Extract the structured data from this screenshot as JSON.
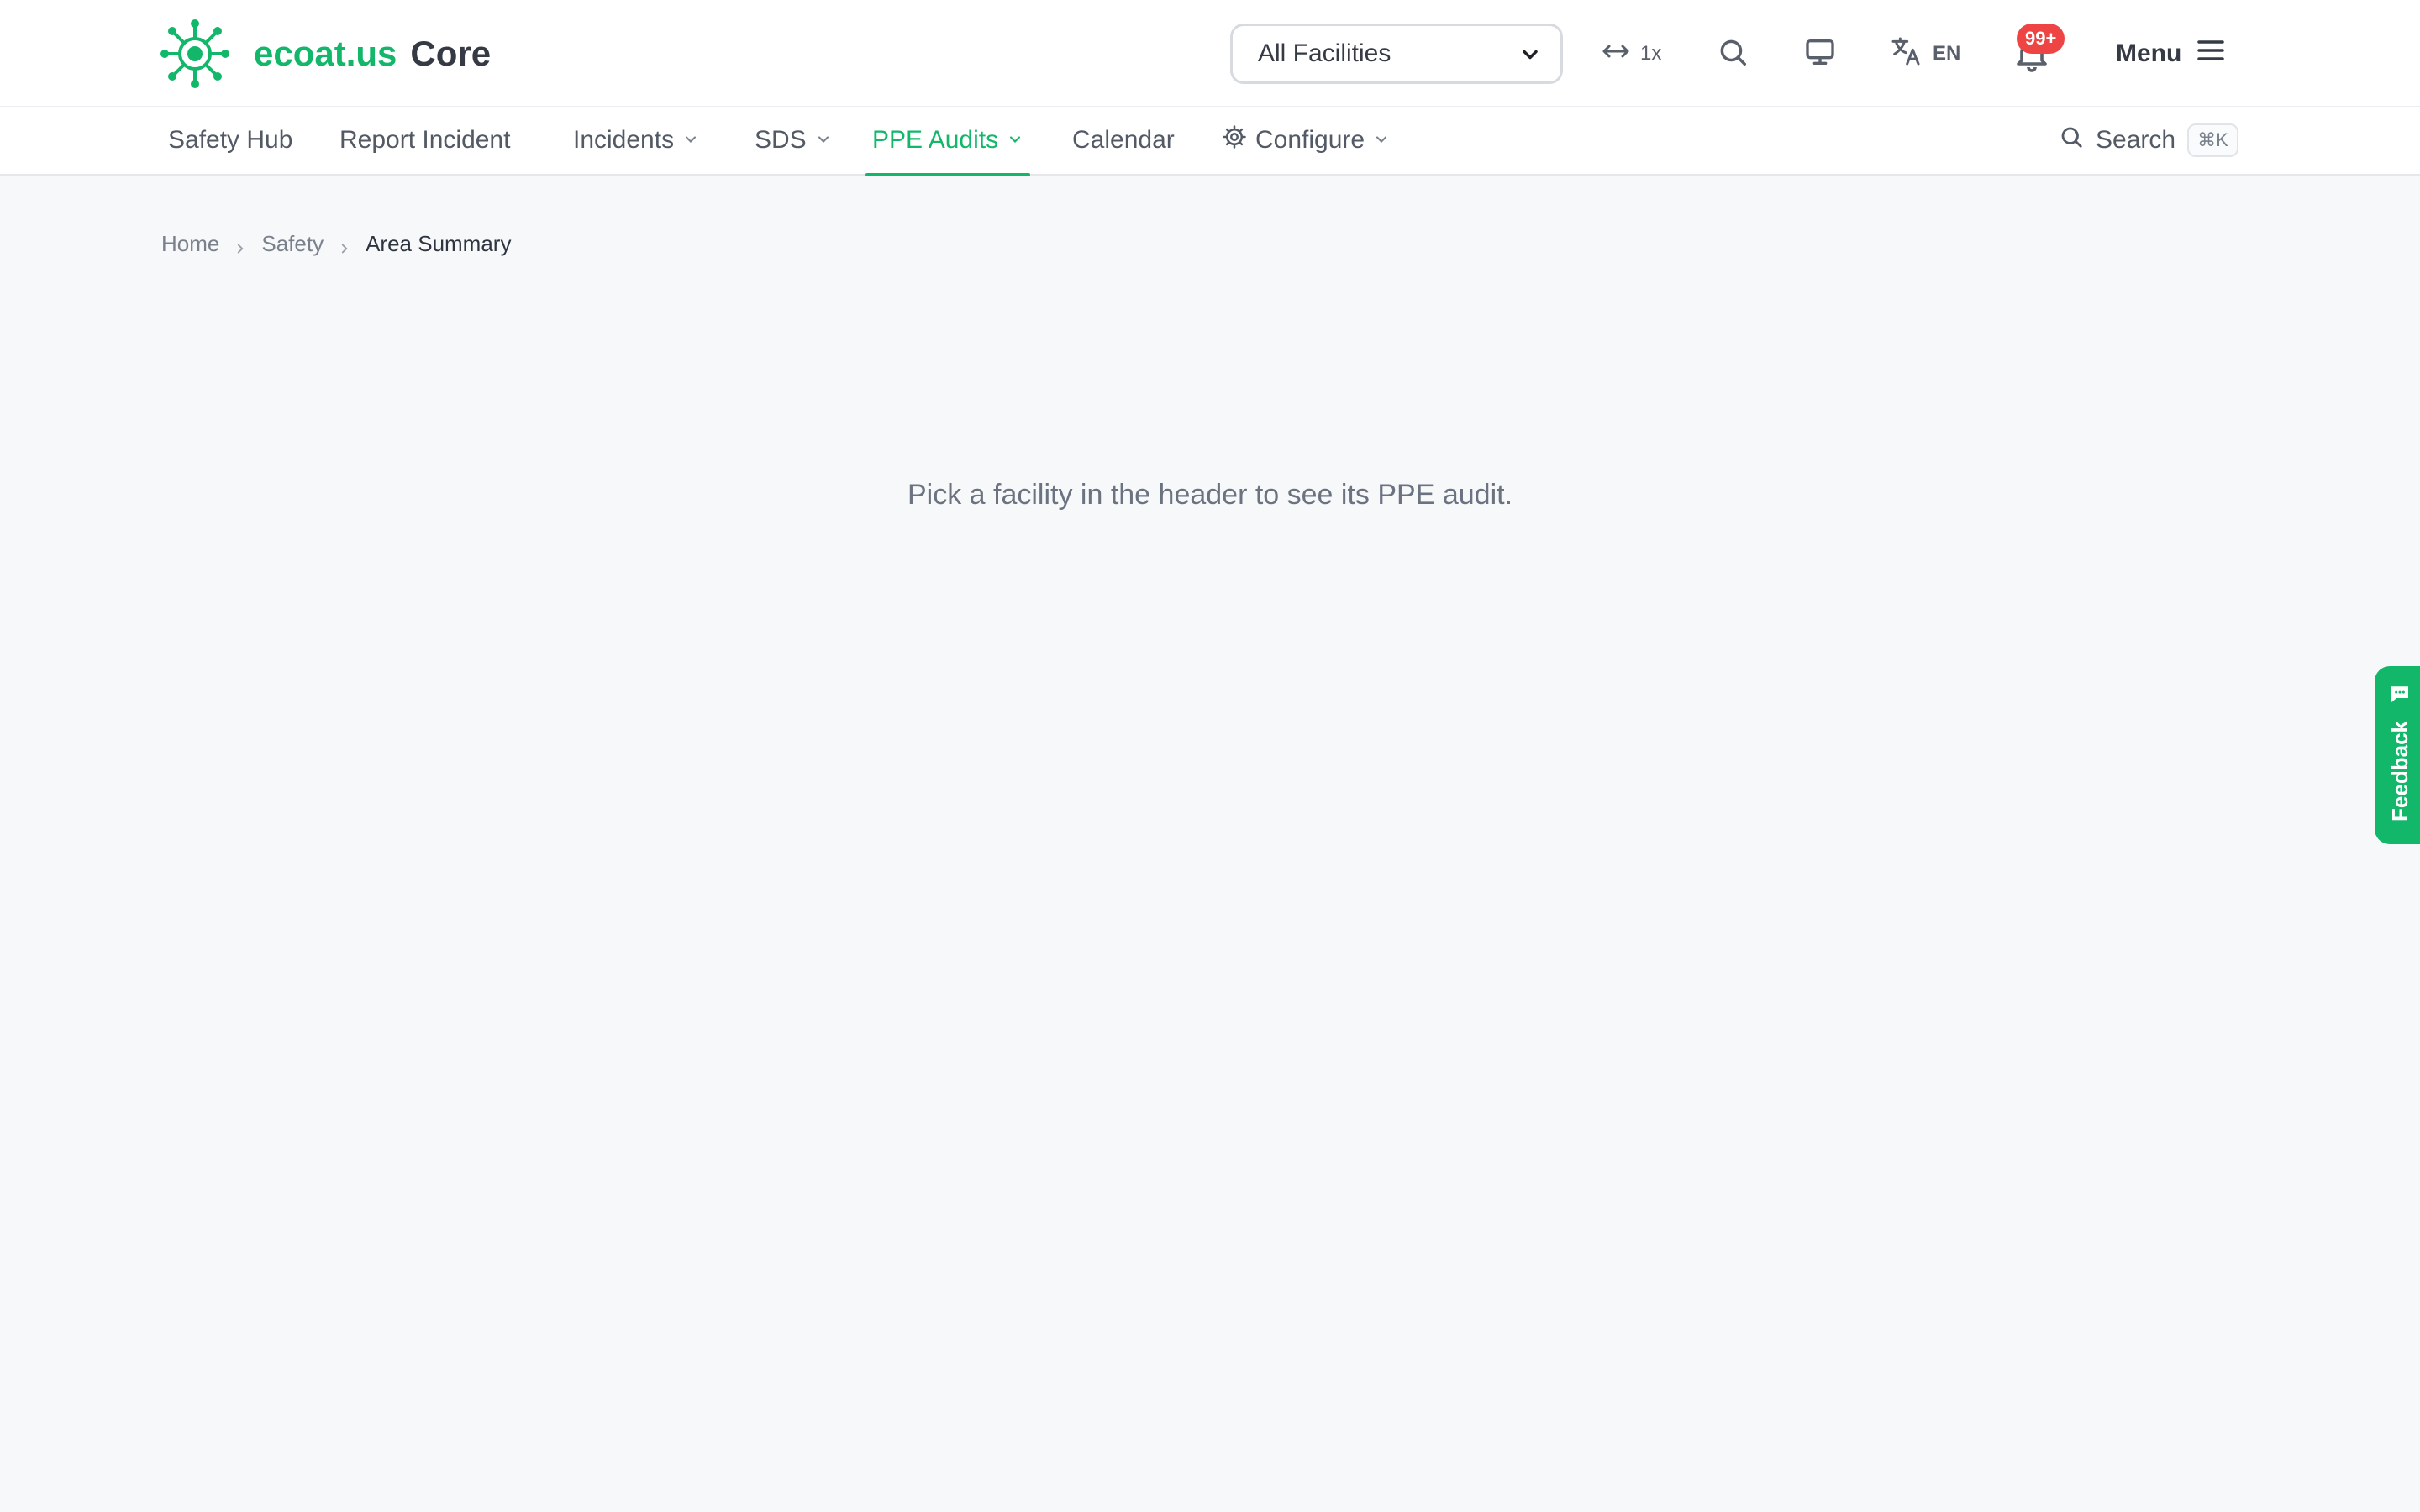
{
  "app": {
    "brand_primary": "ecoat.us",
    "brand_secondary": "Core",
    "accent_color": "#12b76a"
  },
  "header": {
    "facility_select": {
      "value": "All Facilities"
    },
    "zoom_label": "1x",
    "language": "EN",
    "notifications_badge": "99+",
    "menu_label": "Menu",
    "icons": [
      "logo-icon",
      "arrows-horizontal-icon",
      "search-icon",
      "monitor-icon",
      "translate-icon",
      "bell-icon",
      "hamburger-icon"
    ]
  },
  "nav": {
    "items": [
      {
        "label": "Safety Hub",
        "has_dropdown": false
      },
      {
        "label": "Report Incident",
        "has_dropdown": false
      },
      {
        "label": "Incidents",
        "has_dropdown": true
      },
      {
        "label": "SDS",
        "has_dropdown": true
      },
      {
        "label": "PPE Audits",
        "has_dropdown": true,
        "active": true
      },
      {
        "label": "Calendar",
        "has_dropdown": false
      },
      {
        "label": "Configure",
        "has_dropdown": true,
        "icon": "gear-icon"
      }
    ],
    "search_label": "Search",
    "search_shortcut": "⌘K"
  },
  "breadcrumb": {
    "items": [
      "Home",
      "Safety",
      "Area Summary"
    ]
  },
  "main": {
    "empty_message": "Pick a facility in the header to see its PPE audit."
  },
  "feedback": {
    "label": "Feedback",
    "icon": "chat-bubble-icon"
  }
}
